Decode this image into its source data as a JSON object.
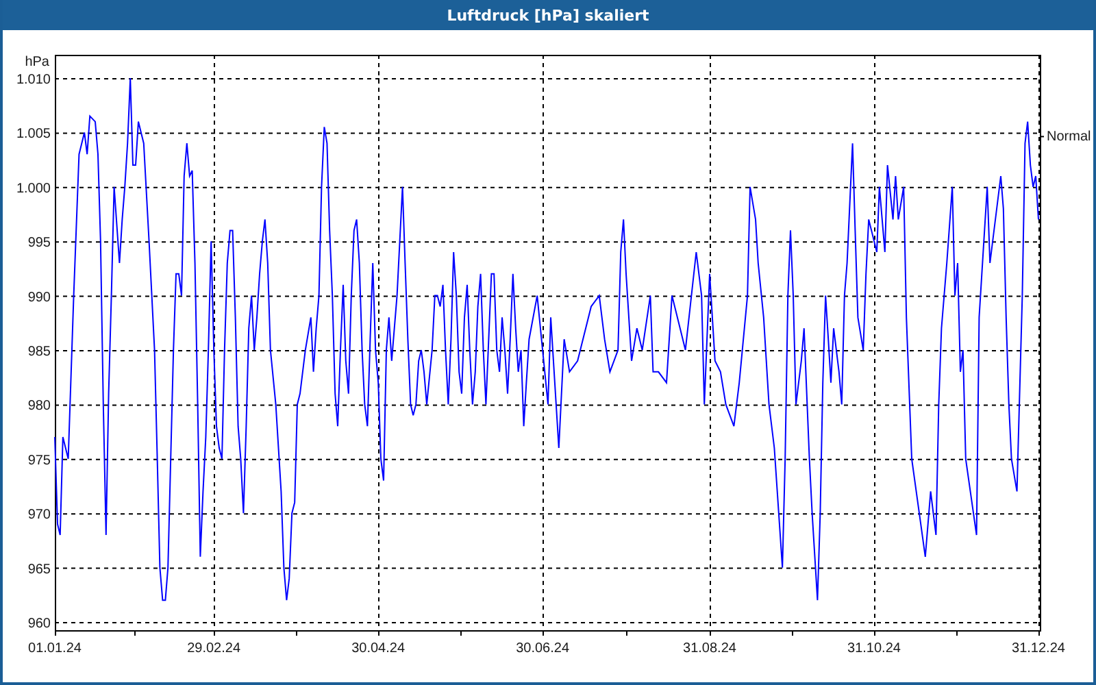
{
  "window": {
    "title": "Luftdruck [hPa] skaliert"
  },
  "chart": {
    "chart_data": {
      "type": "line",
      "ylabel": "hPa",
      "xlim": [
        "2024-01-01",
        "2024-12-31"
      ],
      "ylim": [
        960,
        1010
      ],
      "xticks": [
        {
          "value": "2024-01-01",
          "label": "01.01.24"
        },
        {
          "value": "2024-02-29",
          "label": "29.02.24"
        },
        {
          "value": "2024-04-30",
          "label": "30.04.24"
        },
        {
          "value": "2024-06-30",
          "label": "30.06.24"
        },
        {
          "value": "2024-08-31",
          "label": "31.08.24"
        },
        {
          "value": "2024-10-31",
          "label": "31.10.24"
        },
        {
          "value": "2024-12-31",
          "label": "31.12.24"
        }
      ],
      "yticks": [
        {
          "value": 1010,
          "label": "1.010"
        },
        {
          "value": 1005,
          "label": "1.005"
        },
        {
          "value": 1000,
          "label": "1.000"
        },
        {
          "value": 995,
          "label": "995"
        },
        {
          "value": 990,
          "label": "990"
        },
        {
          "value": 985,
          "label": "985"
        },
        {
          "value": 980,
          "label": "980"
        },
        {
          "value": 975,
          "label": "975"
        },
        {
          "value": 970,
          "label": "970"
        },
        {
          "value": 965,
          "label": "965"
        },
        {
          "value": 960,
          "label": "960"
        }
      ],
      "annotations": [
        "Normal"
      ],
      "grid": true,
      "x": [
        "2024-01-01",
        "2024-01-02",
        "2024-01-03",
        "2024-01-04",
        "2024-01-06",
        "2024-01-08",
        "2024-01-10",
        "2024-01-12",
        "2024-01-13",
        "2024-01-14",
        "2024-01-16",
        "2024-01-17",
        "2024-01-18",
        "2024-01-19",
        "2024-01-20",
        "2024-01-21",
        "2024-01-22",
        "2024-01-23",
        "2024-01-25",
        "2024-01-26",
        "2024-01-27",
        "2024-01-28",
        "2024-01-29",
        "2024-01-30",
        "2024-01-31",
        "2024-02-01",
        "2024-02-03",
        "2024-02-05",
        "2024-02-07",
        "2024-02-08",
        "2024-02-09",
        "2024-02-10",
        "2024-02-11",
        "2024-02-12",
        "2024-02-13",
        "2024-02-14",
        "2024-02-15",
        "2024-02-16",
        "2024-02-17",
        "2024-02-18",
        "2024-02-19",
        "2024-02-20",
        "2024-02-21",
        "2024-02-22",
        "2024-02-23",
        "2024-02-24",
        "2024-02-25",
        "2024-02-26",
        "2024-02-27",
        "2024-02-28",
        "2024-02-29",
        "2024-03-01",
        "2024-03-02",
        "2024-03-03",
        "2024-03-04",
        "2024-03-05",
        "2024-03-06",
        "2024-03-07",
        "2024-03-08",
        "2024-03-09",
        "2024-03-10",
        "2024-03-11",
        "2024-03-12",
        "2024-03-13",
        "2024-03-14",
        "2024-03-15",
        "2024-03-16",
        "2024-03-17",
        "2024-03-18",
        "2024-03-19",
        "2024-03-20",
        "2024-03-21",
        "2024-03-23",
        "2024-03-25",
        "2024-03-26",
        "2024-03-27",
        "2024-03-28",
        "2024-03-29",
        "2024-03-30",
        "2024-03-31",
        "2024-04-01",
        "2024-04-03",
        "2024-04-05",
        "2024-04-06",
        "2024-04-07",
        "2024-04-08",
        "2024-04-09",
        "2024-04-10",
        "2024-04-11",
        "2024-04-12",
        "2024-04-13",
        "2024-04-14",
        "2024-04-15",
        "2024-04-16",
        "2024-04-17",
        "2024-04-18",
        "2024-04-19",
        "2024-04-20",
        "2024-04-21",
        "2024-04-22",
        "2024-04-23",
        "2024-04-24",
        "2024-04-25",
        "2024-04-26",
        "2024-04-27",
        "2024-04-28",
        "2024-04-29",
        "2024-04-30",
        "2024-05-01",
        "2024-05-02",
        "2024-05-03",
        "2024-05-04",
        "2024-05-05",
        "2024-05-07",
        "2024-05-08",
        "2024-05-09",
        "2024-05-10",
        "2024-05-11",
        "2024-05-12",
        "2024-05-13",
        "2024-05-14",
        "2024-05-15",
        "2024-05-16",
        "2024-05-17",
        "2024-05-18",
        "2024-05-20",
        "2024-05-21",
        "2024-05-22",
        "2024-05-23",
        "2024-05-24",
        "2024-05-25",
        "2024-05-26",
        "2024-05-27",
        "2024-05-28",
        "2024-05-29",
        "2024-05-30",
        "2024-05-31",
        "2024-06-01",
        "2024-06-02",
        "2024-06-03",
        "2024-06-04",
        "2024-06-05",
        "2024-06-06",
        "2024-06-07",
        "2024-06-08",
        "2024-06-09",
        "2024-06-10",
        "2024-06-11",
        "2024-06-12",
        "2024-06-13",
        "2024-06-14",
        "2024-06-15",
        "2024-06-16",
        "2024-06-17",
        "2024-06-18",
        "2024-06-19",
        "2024-06-20",
        "2024-06-21",
        "2024-06-22",
        "2024-06-23",
        "2024-06-24",
        "2024-06-25",
        "2024-06-28",
        "2024-07-02",
        "2024-07-03",
        "2024-07-06",
        "2024-07-08",
        "2024-07-10",
        "2024-07-13",
        "2024-07-18",
        "2024-07-21",
        "2024-07-23",
        "2024-07-25",
        "2024-07-28",
        "2024-07-29",
        "2024-07-30",
        "2024-07-31",
        "2024-08-02",
        "2024-08-04",
        "2024-08-06",
        "2024-08-09",
        "2024-08-10",
        "2024-08-12",
        "2024-08-15",
        "2024-08-17",
        "2024-08-20",
        "2024-08-22",
        "2024-08-26",
        "2024-08-28",
        "2024-08-29",
        "2024-08-31",
        "2024-09-02",
        "2024-09-04",
        "2024-09-06",
        "2024-09-09",
        "2024-09-11",
        "2024-09-14",
        "2024-09-15",
        "2024-09-17",
        "2024-09-18",
        "2024-09-20",
        "2024-09-22",
        "2024-09-24",
        "2024-09-27",
        "2024-09-28",
        "2024-09-29",
        "2024-09-30",
        "2024-10-01",
        "2024-10-02",
        "2024-10-04",
        "2024-10-05",
        "2024-10-07",
        "2024-10-08",
        "2024-10-10",
        "2024-10-11",
        "2024-10-12",
        "2024-10-13",
        "2024-10-14",
        "2024-10-15",
        "2024-10-16",
        "2024-10-18",
        "2024-10-19",
        "2024-10-20",
        "2024-10-21",
        "2024-10-23",
        "2024-10-24",
        "2024-10-25",
        "2024-10-27",
        "2024-10-28",
        "2024-10-29",
        "2024-11-01",
        "2024-11-02",
        "2024-11-04",
        "2024-11-05",
        "2024-11-07",
        "2024-11-08",
        "2024-11-09",
        "2024-11-11",
        "2024-11-12",
        "2024-11-14",
        "2024-11-19",
        "2024-11-21",
        "2024-11-23",
        "2024-11-24",
        "2024-11-25",
        "2024-11-27",
        "2024-11-29",
        "2024-11-30",
        "2024-12-01",
        "2024-12-02",
        "2024-12-03",
        "2024-12-04",
        "2024-12-08",
        "2024-12-09",
        "2024-12-12",
        "2024-12-13",
        "2024-12-17",
        "2024-12-18",
        "2024-12-19",
        "2024-12-20",
        "2024-12-21",
        "2024-12-23",
        "2024-12-25",
        "2024-12-26",
        "2024-12-27",
        "2024-12-28",
        "2024-12-29",
        "2024-12-30",
        "2024-12-31"
      ],
      "series": [
        {
          "color": "#0000ff",
          "values": [
            977,
            969,
            968,
            977,
            975,
            990,
            1003,
            1005,
            1003,
            1006.5,
            1006,
            1003,
            995,
            980,
            968,
            981,
            990,
            1000,
            993,
            997,
            1000,
            1004,
            1010,
            1002,
            1002,
            1006,
            1004,
            995,
            985,
            975,
            965,
            962,
            962,
            965,
            975,
            985,
            992,
            992,
            990,
            1001,
            1004,
            1001,
            1001.5,
            993,
            980,
            966,
            972,
            977,
            985,
            995,
            985,
            978,
            976,
            975,
            985,
            993,
            996,
            996,
            988,
            978,
            975,
            970,
            978,
            987,
            990,
            985,
            988,
            992,
            995,
            997,
            993,
            985,
            980,
            972,
            965,
            962,
            964,
            970,
            971,
            980,
            981,
            985,
            988,
            983,
            987,
            990,
            1000,
            1005.5,
            1004,
            996,
            990,
            981,
            978,
            985,
            991,
            984,
            981,
            990,
            996,
            997,
            993,
            985,
            980,
            978,
            986,
            993,
            985,
            982,
            975,
            973,
            985,
            988,
            984,
            990,
            995,
            1000,
            993,
            986,
            980,
            979,
            980,
            984,
            985,
            983,
            980,
            985,
            990,
            990,
            989,
            991,
            985,
            980,
            986,
            994,
            990,
            983,
            981,
            988,
            991,
            985,
            980,
            983,
            989,
            992,
            985,
            980,
            986,
            992,
            992,
            985,
            983,
            988,
            985,
            981,
            986,
            992,
            987,
            983,
            985,
            978,
            982,
            986,
            990,
            980,
            988,
            976,
            986,
            983,
            984,
            989,
            990,
            986,
            983,
            985,
            994,
            997,
            992,
            984,
            987,
            985,
            990,
            983,
            983,
            982,
            990,
            987,
            985,
            994,
            990,
            980,
            992,
            984,
            983,
            980,
            978,
            982,
            990,
            1000,
            997,
            993,
            988,
            980,
            976,
            965,
            975,
            990,
            996,
            990,
            980,
            984,
            987,
            975,
            970,
            962,
            970,
            982,
            990,
            986,
            982,
            987,
            983,
            980,
            990,
            993,
            1004,
            996,
            988,
            985,
            992,
            997,
            994,
            1000,
            994,
            1002,
            997,
            1001,
            997,
            1000,
            988,
            975,
            966,
            972,
            968,
            980,
            987,
            993,
            1000,
            990,
            993,
            983,
            985,
            975,
            968,
            988,
            1000,
            993,
            1001,
            998,
            988,
            980,
            975,
            972,
            990,
            1004,
            1006,
            1002,
            1000,
            1001,
            997
          ]
        }
      ]
    }
  }
}
